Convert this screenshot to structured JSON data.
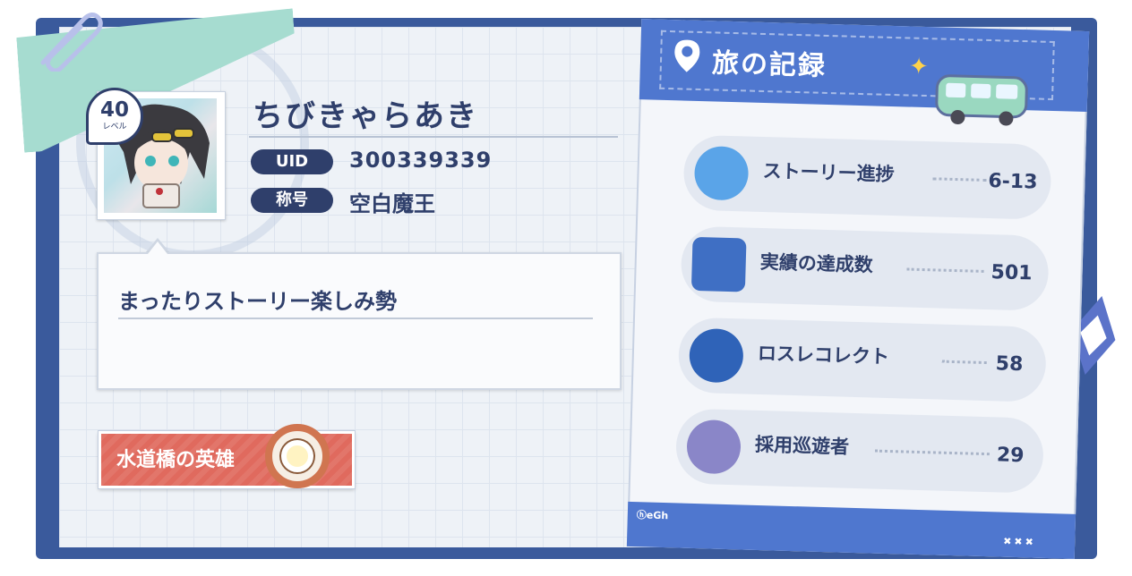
{
  "profile": {
    "level": "40",
    "level_label": "レベル",
    "name": "ちびきゃらあき",
    "uid_label": "UID",
    "uid_value": "300339339",
    "title_label": "称号",
    "title_value": "空白魔王",
    "bio": "まったりストーリー楽しみ勢"
  },
  "hero_badge": {
    "text": "水道橋の英雄"
  },
  "journey": {
    "title": "旅の記録",
    "rows": [
      {
        "label": "ストーリー進捗",
        "value": "6-13",
        "icon": "story-orbit-icon"
      },
      {
        "label": "実績の達成数",
        "value": "501",
        "icon": "achievement-book-icon"
      },
      {
        "label": "ロスレコレクト",
        "value": "58",
        "icon": "music-disc-icon"
      },
      {
        "label": "採用巡遊者",
        "value": "29",
        "icon": "character-portrait-icon"
      }
    ],
    "footer_brand": "ⓗeGh",
    "footer_marks": "✖✖✖"
  },
  "colors": {
    "navy": "#2f3f6b",
    "frame_blue": "#3a5a9c",
    "panel_blue": "#4f77cf",
    "hero_red": "#e06a5e"
  }
}
